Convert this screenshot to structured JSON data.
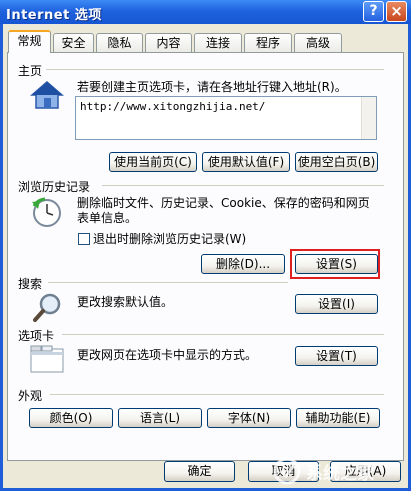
{
  "window": {
    "title": "Internet 选项",
    "help_glyph": "?",
    "close_glyph": "×"
  },
  "tabs": [
    "常规",
    "安全",
    "隐私",
    "内容",
    "连接",
    "程序",
    "高级"
  ],
  "home": {
    "group_label": "主页",
    "description": "若要创建主页选项卡，请在各地址行键入地址(R)。",
    "url": "http://www.xitongzhijia.net/",
    "buttons": {
      "use_current": "使用当前页(C)",
      "use_default": "使用默认值(F)",
      "use_blank": "使用空白页(B)"
    }
  },
  "history": {
    "group_label": "浏览历史记录",
    "description_line1": "删除临时文件、历史记录、Cookie、保存的密码和网页",
    "description_line2": "表单信息。",
    "checkbox_label": "退出时删除浏览历史记录(W)",
    "checkbox_checked": false,
    "delete_button": "删除(D)...",
    "settings_button": "设置(S)"
  },
  "search": {
    "group_label": "搜索",
    "description": "更改搜索默认值。",
    "settings_button": "设置(I)"
  },
  "tabs_section": {
    "group_label": "选项卡",
    "description": "更改网页在选项卡中显示的方式。",
    "settings_button": "设置(T)"
  },
  "appearance": {
    "group_label": "外观",
    "buttons": {
      "colors": "颜色(O)",
      "languages": "语言(L)",
      "fonts": "字体(N)",
      "accessibility": "辅助功能(E)"
    }
  },
  "footer": {
    "ok": "确定",
    "cancel": "取消",
    "apply": "应用(A)"
  },
  "watermark": "系统之家",
  "colors": {
    "titlebar": "#1f63df",
    "highlight": "#e02020",
    "dialog_bg": "#ece9d8"
  }
}
